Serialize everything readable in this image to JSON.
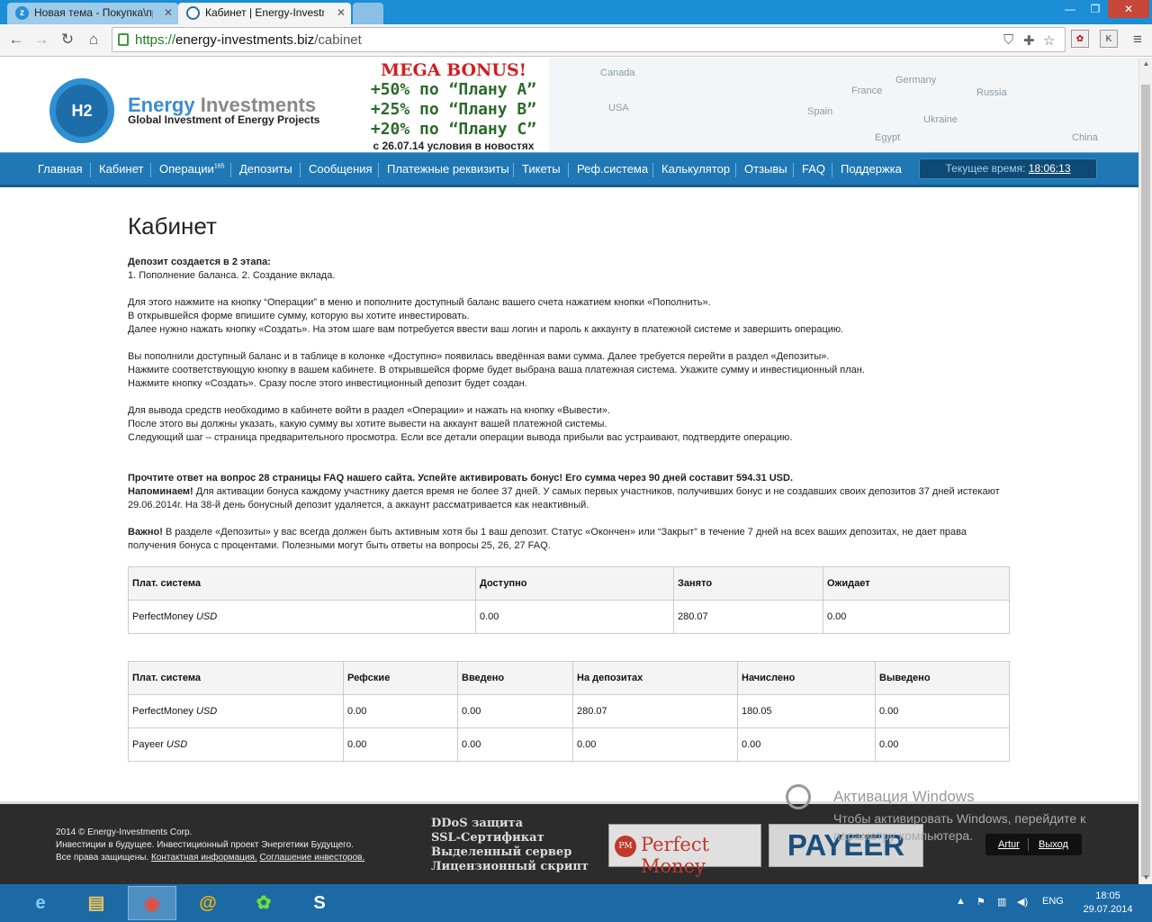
{
  "browser": {
    "tabs": [
      {
        "label": "Новая тема - Покупка\\пр"
      },
      {
        "label": "Кабинет | Energy-Investm"
      }
    ],
    "url_prefix": "https://",
    "url_host": "energy-investments.biz",
    "url_path": "/cabinet"
  },
  "header": {
    "logo_mark": "H2",
    "logo_name_a": "Energy",
    "logo_name_b": " Investments",
    "logo_tagline": "Global Investment of Energy Projects",
    "bonus_title": "MEGA BONUS!",
    "bonus_lines": [
      "+50% по “Плану А”",
      "+25% по “Плану В”",
      "+20% по “Плану С”"
    ],
    "bonus_note": "с 26.07.14 условия в новостях",
    "countries": [
      "Canada",
      "USA",
      "Germany",
      "France",
      "Russia",
      "Spain",
      "Ukraine",
      "Egypt",
      "China"
    ]
  },
  "menu": {
    "items": [
      "Главная",
      "Кабинет",
      "Операции",
      "Депозиты",
      "Сообщения",
      "Платежные реквизиты",
      "Тикеты",
      "Реф.система",
      "Калькулятор",
      "Отзывы",
      "FAQ",
      "Поддержка"
    ],
    "operations_badge": "165",
    "clock_label": "Текущее время:",
    "clock_value": "18:06:13"
  },
  "content": {
    "title": "Кабинет",
    "intro_bold": "Депозит создается в 2 этапа:",
    "intro_rest": "1. Пополнение баланса. 2. Создание вклада.",
    "para1": [
      "Для этого нажмите на кнопку “Операции” в меню и пополните доступный баланс вашего счета нажатием кнопки «Пополнить».",
      "В открывшейся форме впишите сумму, которую вы хотите инвестировать.",
      "Далее нужно нажать кнопку «Создать». На этом шаге вам потребуется ввести ваш логин и пароль к аккаунту в платежной системе и завершить операцию."
    ],
    "para2": [
      "Вы пополнили доступный баланс и в таблице в колонке «Доступно» появилась введённая вами сумма. Далее требуется перейти в раздел «Депозиты».",
      "Нажмите соответствующую кнопку в вашем кабинете. В открывшейся форме будет выбрана ваша платежная система. Укажите сумму и инвестиционный план.",
      "Нажмите кнопку «Создать». Сразу после этого инвестиционный депозит будет создан."
    ],
    "para3": [
      "Для вывода средств необходимо в кабинете войти в раздел «Операции» и нажать на кнопку «Вывести».",
      "После этого вы должны указать, какую сумму вы хотите вывести на аккаунт вашей платежной системы.",
      "Следующий шаг – страница предварительного просмотра. Если все детали операции вывода прибыли вас устраивают, подтвердите операцию."
    ],
    "faq_note": "Прочтите ответ на вопрос 28 страницы FAQ нашего сайта. Успейте активировать бонус! Его сумма через 90 дней составит 594.31 USD.",
    "remind_label": "Напоминаем!",
    "remind_text": " Для активации бонуса каждому участнику дается время не более 37 дней. У самых первых участников, получивших бонус и не создавших своих депозитов 37 дней истекают 29.06.2014г. На 38-й день бонусный депозит удаляется, а аккаунт рассматривается как неактивный.",
    "important_label": "Важно!",
    "important_text": " В разделе «Депозиты» у вас всегда должен быть активным хотя бы 1 ваш депозит. Статус «Окончен» или “Закрыт” в течение 7 дней на всех ваших депозитах, не дает права получения бонуса с процентами. Полезными могут быть ответы на вопросы 25, 26, 27 FAQ."
  },
  "table1": {
    "headers": [
      "Плат. система",
      "Доступно",
      "Занято",
      "Ожидает"
    ],
    "rows": [
      {
        "system": "PerfectMoney",
        "currency": "USD",
        "values": [
          "0.00",
          "280.07",
          "0.00"
        ]
      }
    ]
  },
  "table2": {
    "headers": [
      "Плат. система",
      "Рефские",
      "Введено",
      "На депозитах",
      "Начислено",
      "Выведено"
    ],
    "rows": [
      {
        "system": "PerfectMoney",
        "currency": "USD",
        "values": [
          "0.00",
          "0.00",
          "280.07",
          "180.05",
          "0.00"
        ]
      },
      {
        "system": "Payeer",
        "currency": "USD",
        "values": [
          "0.00",
          "0.00",
          "0.00",
          "0.00",
          "0.00"
        ]
      }
    ]
  },
  "footer": {
    "copyright": "2014 © Energy-Investments Corp.",
    "line2": "Инвестиции в будущее. Инвестиционный проект Энергетики Будущего.",
    "line3": "Все права защищены.",
    "link_contacts": "Контактная информация.",
    "link_agreement": "Соглашение инвесторов.",
    "features": [
      "DDoS защита",
      "SSL-Сертификат",
      "Выделенный сервер",
      "Лицензионный скрипт"
    ],
    "pm_mark": "PM",
    "pm_label": "Perfect Money",
    "payeer_label": "PAYEER",
    "user_link": "Artur",
    "logout_link": "Выход"
  },
  "watermark": {
    "title": "Активация Windows",
    "text": "Чтобы активировать Windows, перейдите к параметру компьютера."
  },
  "taskbar": {
    "lang": "ENG",
    "time": "18:05",
    "date": "29.07.2014"
  }
}
